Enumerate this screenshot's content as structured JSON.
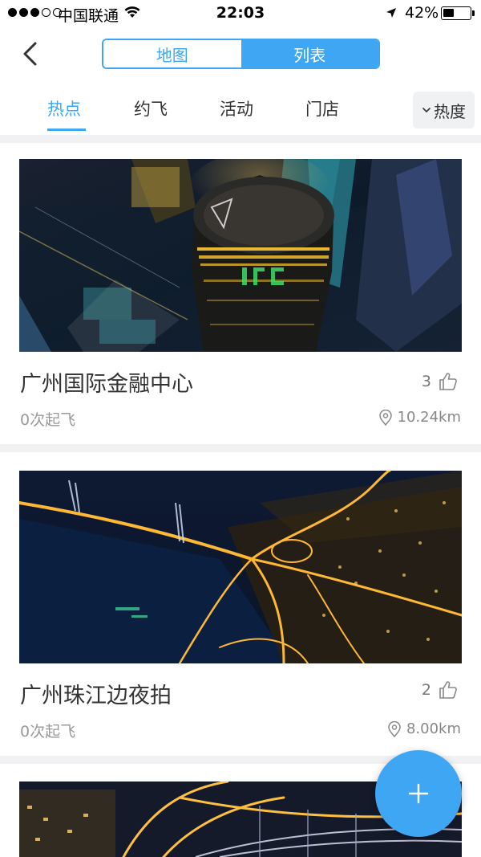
{
  "status_bar": {
    "carrier": "中国联通",
    "time": "22:03",
    "battery_percent": "42%",
    "battery_level": 0.42,
    "signal_bars": 3,
    "signal_total": 5
  },
  "nav": {
    "back_icon": "chevron-left-icon",
    "segments": [
      {
        "label": "地图",
        "selected": false
      },
      {
        "label": "列表",
        "selected": true
      }
    ]
  },
  "tabs": [
    {
      "label": "热点",
      "active": true
    },
    {
      "label": "约飞",
      "active": false
    },
    {
      "label": "活动",
      "active": false
    },
    {
      "label": "门店",
      "active": false
    }
  ],
  "sort": {
    "label": "热度",
    "icon": "chevron-down-icon"
  },
  "spots": [
    {
      "title": "广州国际金融中心",
      "likes": "3",
      "flights": "0次起飞",
      "distance": "10.24km"
    },
    {
      "title": "广州珠江边夜拍",
      "likes": "2",
      "flights": "0次起飞",
      "distance": "8.00km"
    },
    {
      "title": "",
      "likes": "",
      "flights": "",
      "distance": ""
    }
  ],
  "fab": {
    "icon": "plus-icon"
  },
  "colors": {
    "accent": "#3ea6f2",
    "divider": "#f1f1f3",
    "text_primary": "#333333",
    "text_secondary": "#999999"
  }
}
